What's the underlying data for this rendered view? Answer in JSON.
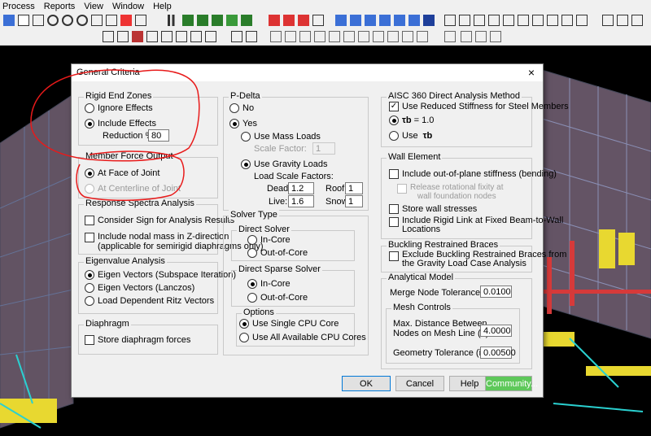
{
  "menubar": {
    "items": [
      "Process",
      "Reports",
      "View",
      "Window",
      "Help"
    ]
  },
  "dialog": {
    "title": "General Criteria",
    "close_glyph": "×",
    "rigid_end_zones": {
      "label": "Rigid End Zones",
      "ignore": "Ignore Effects",
      "include": "Include Effects",
      "reduction_label": "Reduction %:",
      "reduction_value": "80"
    },
    "member_force_output": {
      "label": "Member Force Output",
      "at_face": "At Face of Joint",
      "at_centerline": "At Centerline of Joint"
    },
    "response_spectra": {
      "label": "Response Spectra Analysis",
      "consider_sign": "Consider Sign for Analysis Results",
      "include_nodal_1": "Include nodal mass in Z-direction",
      "include_nodal_2": "(applicable for semirigid diaphragms only)"
    },
    "eigenvalue": {
      "label": "Eigenvalue Analysis",
      "subspace": "Eigen Vectors (Subspace Iteration)",
      "lanczos": "Eigen Vectors (Lanczos)",
      "ritz": "Load Dependent Ritz Vectors"
    },
    "diaphragm": {
      "label": "Diaphragm",
      "store": "Store diaphragm forces"
    },
    "pdelta": {
      "label": "P-Delta",
      "no": "No",
      "yes": "Yes",
      "mass_loads": "Use Mass Loads",
      "scale_factor_label": "Scale Factor:",
      "scale_factor_value": "1",
      "gravity_loads": "Use Gravity Loads",
      "load_scale_label": "Load Scale Factors:",
      "dead_label": "Dead:",
      "dead_value": "1.2",
      "live_label": "Live:",
      "live_value": "1.6",
      "roof_label": "Roof:",
      "roof_value": "1",
      "snow_label": "Snow:",
      "snow_value": "1"
    },
    "solver": {
      "label": "Solver Type",
      "direct": {
        "label": "Direct Solver",
        "incore": "In-Core",
        "outcore": "Out-of-Core"
      },
      "sparse": {
        "label": "Direct Sparse Solver",
        "incore": "In-Core",
        "outcore": "Out-of-Core"
      },
      "options": {
        "label": "Options",
        "single": "Use Single CPU Core",
        "all": "Use All Available CPU Cores"
      }
    },
    "aisc": {
      "label": "AISC 360 Direct Analysis Method",
      "reduced_stiffness": "Use Reduced Stiffness for Steel Members",
      "tau_symbol": "τb",
      "tau_eq": "= 1.0",
      "use_label": "Use"
    },
    "wall": {
      "label": "Wall Element",
      "out_of_plane": "Include out-of-plane stiffness (bending)",
      "release_1": "Release rotational fixity at",
      "release_2": "wall foundation nodes",
      "store_stresses": "Store wall stresses",
      "rigid_link_1": "Include Rigid Link at Fixed Beam-to-Wall",
      "rigid_link_2": "Locations"
    },
    "buckling": {
      "label": "Buckling Restrained Braces",
      "exclude_1": "Exclude Buckling Restrained Braces from",
      "exclude_2": "the Gravity Load Case Analysis"
    },
    "analytical": {
      "label": "Analytical Model",
      "merge_label": "Merge Node Tolerance (in):",
      "merge_value": "0.0100",
      "mesh": {
        "label": "Mesh Controls",
        "max_dist_1": "Max. Distance Between",
        "max_dist_2": "Nodes on Mesh Line (ft):",
        "max_dist_value": "4.0000",
        "geom_label": "Geometry Tolerance (in) :",
        "geom_value": "0.00500"
      }
    },
    "buttons": {
      "ok": "OK",
      "cancel": "Cancel",
      "help": "Help",
      "community": "Community..."
    }
  },
  "colors": {
    "annotation": "#e81a1a",
    "community_button": "#5ec85a",
    "ok_border": "#0078d7"
  }
}
